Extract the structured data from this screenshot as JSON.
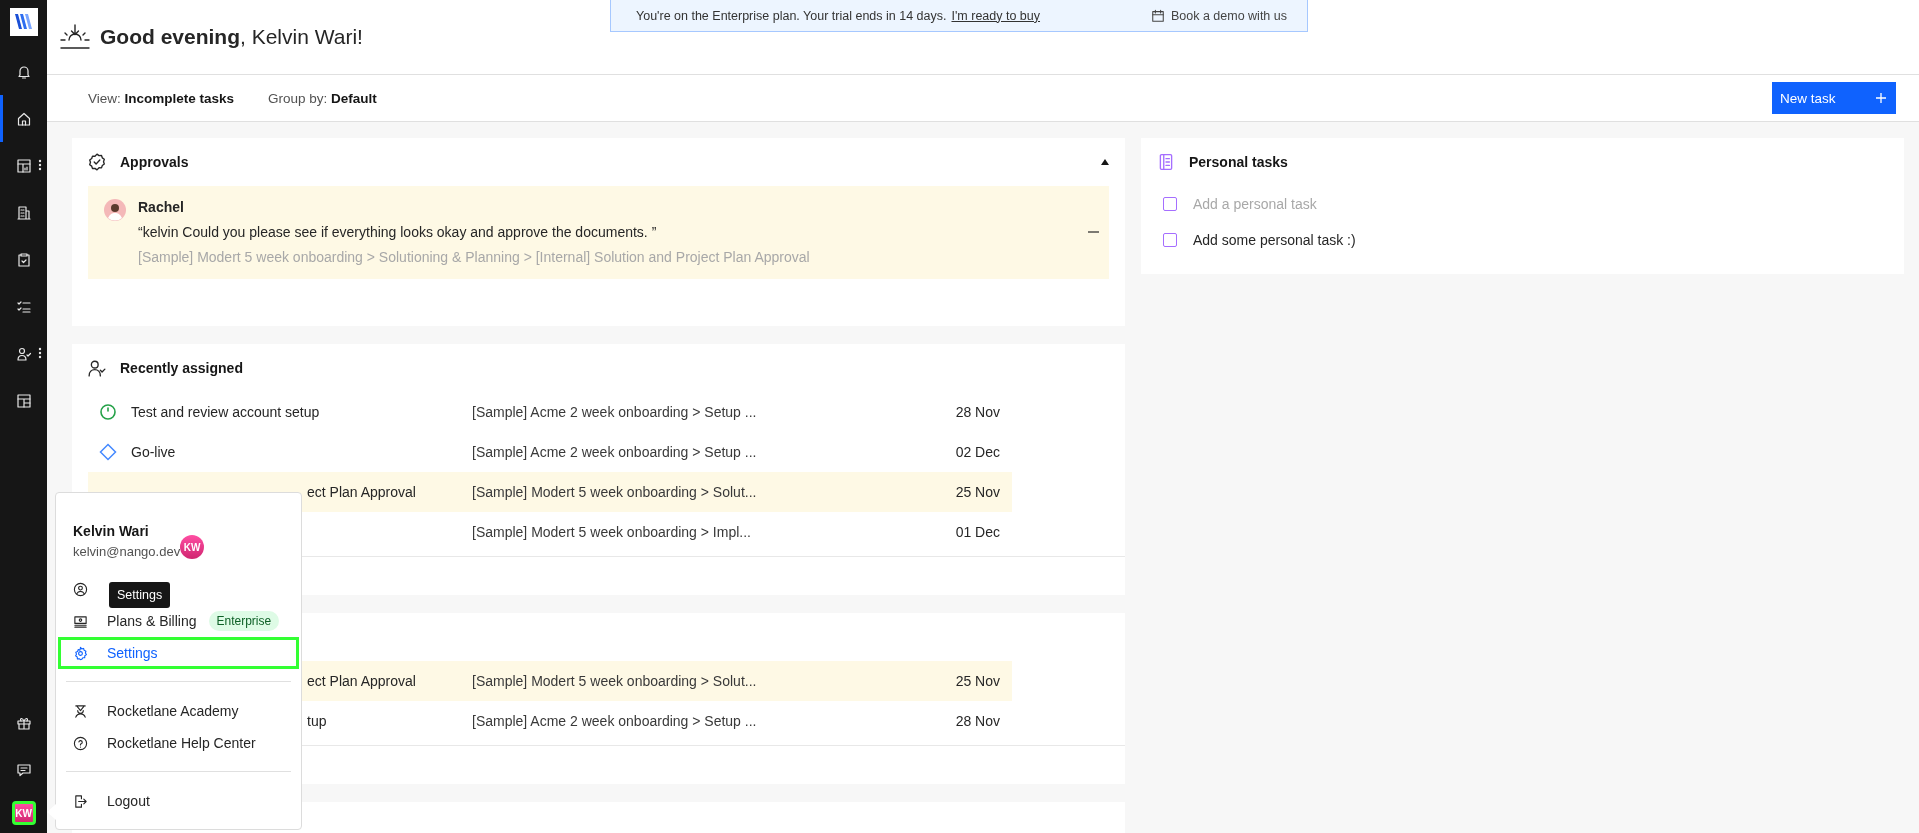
{
  "sidebar": {
    "items": [
      {
        "kind": "bell",
        "selected": false,
        "submenu": false
      },
      {
        "kind": "home",
        "selected": true,
        "submenu": false
      },
      {
        "kind": "dashboard",
        "selected": false,
        "submenu": true
      },
      {
        "kind": "building",
        "selected": false,
        "submenu": false
      },
      {
        "kind": "clipboard",
        "selected": false,
        "submenu": false
      },
      {
        "kind": "checklist",
        "selected": false,
        "submenu": false
      },
      {
        "kind": "people",
        "selected": false,
        "submenu": true
      },
      {
        "kind": "layout",
        "selected": false,
        "submenu": false
      }
    ],
    "bottom_items": [
      {
        "kind": "gift",
        "selected": false
      },
      {
        "kind": "chat",
        "selected": false
      }
    ],
    "avatar": {
      "initials": "KW",
      "selected": true
    }
  },
  "greeting": "**Good evening**, Kelvin Wari!",
  "banner": {
    "message": "You're on the Enterprise plan. Your trial ends in 14 days.",
    "link": "I'm ready to buy",
    "action": "Book a demo with us"
  },
  "toolbar": {
    "view": "View: **Incomplete tasks**",
    "group_by": "Group by: **Default**",
    "new_task_button": "New task"
  },
  "approvals": {
    "title": "Approvals",
    "expanded": true,
    "items": [
      {
        "author": "Rachel",
        "message": "“kelvin Could you please see if everything looks okay and approve the documents. ”",
        "path": "[Sample] Modert 5 week onboarding > Solutioning & Planning > [Internal] Solution and Project Plan Approval"
      }
    ]
  },
  "recently_assigned": {
    "title": "Recently assigned",
    "rows": [
      {
        "kind": "task",
        "title": "Test and review account setup",
        "project": "[Sample] Acme 2 week onboarding > Setup ...",
        "date": "28 Nov",
        "highlighted": false
      },
      {
        "kind": "milestone",
        "title": "Go-live",
        "project": "[Sample] Acme 2 week onboarding > Setup ...",
        "date": "02 Dec",
        "highlighted": false
      },
      {
        "title": "ect Plan Approval",
        "project": "[Sample] Modert 5 week onboarding > Solut...",
        "date": "25 Nov",
        "highlighted": true
      },
      {
        "project": "[Sample] Modert 5 week onboarding > Impl...",
        "date": "01 Dec",
        "highlighted": false
      }
    ]
  },
  "section_3": {
    "rows": [
      {
        "title": "ect Plan Approval",
        "project": "[Sample] Modert 5 week onboarding > Solut...",
        "date": "25 Nov",
        "highlighted": true
      },
      {
        "title": "tup",
        "project": "[Sample] Acme 2 week onboarding > Setup ...",
        "date": "28 Nov",
        "highlighted": false
      }
    ]
  },
  "personal_tasks": {
    "title": "Personal tasks",
    "placeholder": "Add a personal task",
    "new_task_checked": false,
    "items": [
      {
        "label": "Add some personal task :)",
        "checked": false
      }
    ]
  },
  "user_menu": {
    "name": "Kelvin Wari",
    "email": "kelvin@nango.dev",
    "initials": "KW",
    "tooltip": "Settings",
    "sections": [
      {
        "items": [
          {
            "kind": "profile",
            "selected": false
          },
          {
            "kind": "billing",
            "label": "Plans & Billing",
            "badge": "Enterprise",
            "selected": false
          },
          {
            "kind": "settings",
            "label": "Settings",
            "selected": true
          }
        ]
      },
      {
        "items": [
          {
            "kind": "academy",
            "label": "Rocketlane Academy",
            "selected": false
          },
          {
            "kind": "help",
            "label": "Rocketlane Help Center",
            "selected": false
          }
        ]
      },
      {
        "items": [
          {
            "kind": "logout",
            "label": "Logout",
            "selected": false
          }
        ]
      }
    ]
  }
}
